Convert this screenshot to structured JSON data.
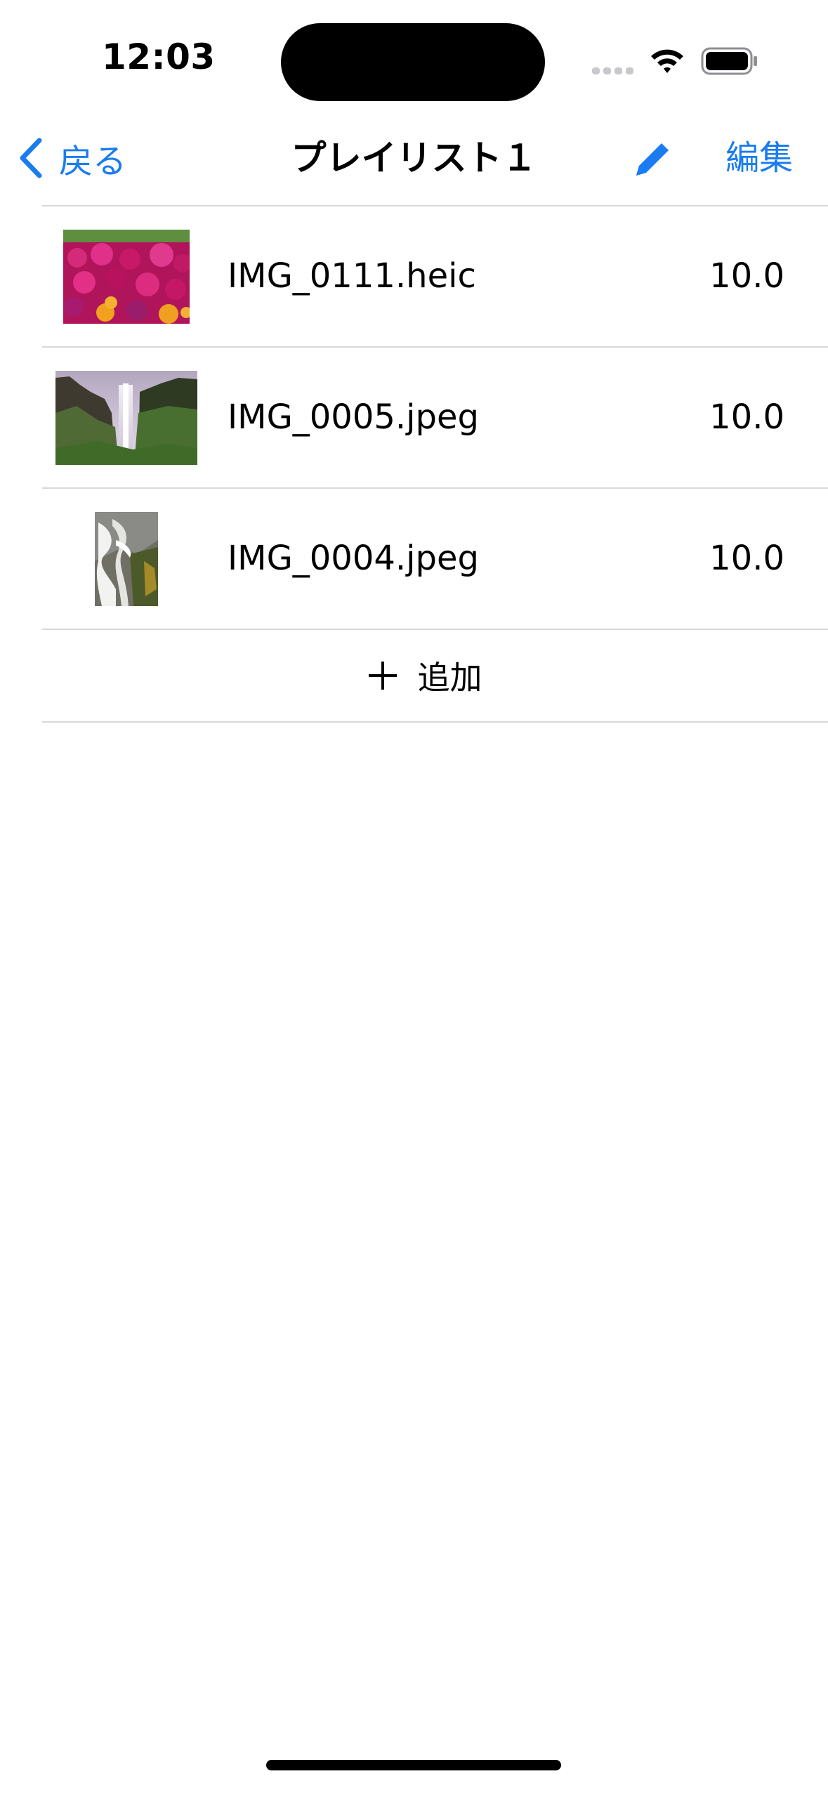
{
  "status_bar": {
    "time": "12:03"
  },
  "nav": {
    "back_label": "戻る",
    "title": "プレイリスト１",
    "edit_label": "編集",
    "accent_color": "#1a7cf0"
  },
  "items": [
    {
      "name": "IMG_0111.heic",
      "value": "10.0",
      "thumbnail": "flowers-photo"
    },
    {
      "name": "IMG_0005.jpeg",
      "value": "10.0",
      "thumbnail": "waterfall-landscape-photo"
    },
    {
      "name": "IMG_0004.jpeg",
      "value": "10.0",
      "thumbnail": "waterfall-portrait-photo"
    }
  ],
  "add_button": {
    "label": "追加",
    "icon": "plus-icon"
  }
}
